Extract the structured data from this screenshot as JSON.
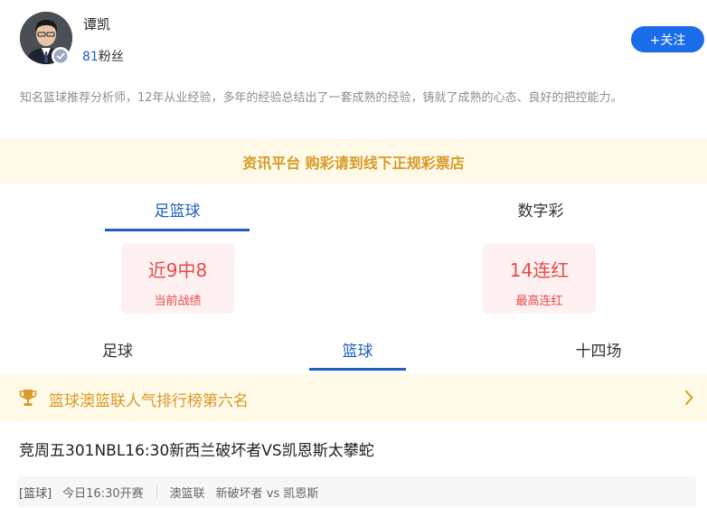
{
  "profile": {
    "name": "谭凯",
    "fans_count": "81",
    "fans_label": "粉丝",
    "follow_label": "+关注",
    "bio": "知名篮球推荐分析师，12年从业经验，多年的经验总结出了一套成熟的经验，铸就了成熟的心态、良好的把控能力。"
  },
  "notice": "资讯平台 购彩请到线下正规彩票店",
  "main_tabs": [
    {
      "label": "足篮球",
      "active": true
    },
    {
      "label": "数字彩",
      "active": false
    }
  ],
  "stats": [
    {
      "value": "近9中8",
      "label": "当前战绩"
    },
    {
      "value": "14连红",
      "label": "最高连红"
    }
  ],
  "sub_tabs": [
    {
      "label": "足球",
      "active": false
    },
    {
      "label": "篮球",
      "active": true
    },
    {
      "label": "十四场",
      "active": false
    }
  ],
  "ranking": {
    "text": "篮球澳篮联人气排行榜第六名",
    "icon": "trophy-icon"
  },
  "match": {
    "title": "竞周五301NBL16:30新西兰破坏者VS凯恩斯太攀蛇",
    "tag": "[篮球]",
    "time": "今日16:30开赛",
    "league": "澳篮联",
    "teams": "新破坏者 vs 凯恩斯"
  },
  "colors": {
    "accent": "#1f5fc4",
    "button": "#1a6ce8",
    "gold": "#d79b27",
    "red": "#e84a4a",
    "notice_bg": "#fff9e8",
    "stat_bg": "#fff1f1"
  }
}
